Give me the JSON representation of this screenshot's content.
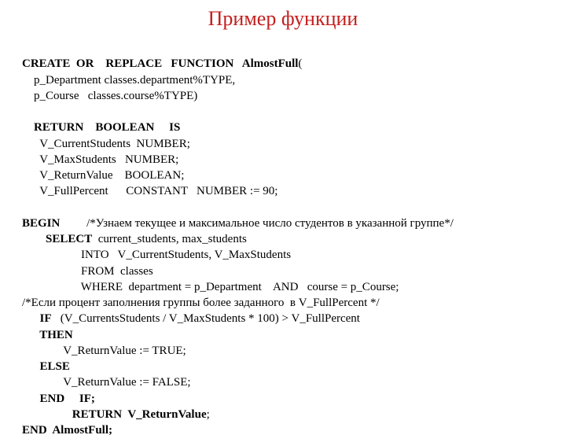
{
  "title": "Пример функции",
  "lines": {
    "l1a": "CREATE  OR    REPLACE   FUNCTION   AlmostFull",
    "l1b": "(",
    "l2": "    p_Department classes.department%TYPE,",
    "l3": "    p_Course   classes.course%TYPE)",
    "blank1": "",
    "l4a": "    RETURN    BOOLEAN     IS",
    "l5": "      V_CurrentStudents  NUMBER;",
    "l6": "      V_MaxStudents   NUMBER;",
    "l7": "      V_ReturnValue    BOOLEAN;",
    "l8": "      V_FullPercent      CONSTANT   NUMBER := 90;",
    "blank2": "",
    "l9a": "BEGIN",
    "l9b": "         /*Узнаем текущее и максимальное число студентов в указанной группе*/",
    "l10a": "        SELECT",
    "l10b": "  current_students, max_students",
    "l11": "                    INTO   V_CurrentStudents, V_MaxStudents",
    "l12": "                    FROM  classes",
    "l13": "                    WHERE  department = p_Department    AND   course = p_Course;",
    "l14": "/*Если процент заполнения группы более заданного  в V_FullPercent */",
    "l15a": "      IF",
    "l15b": "   (V_CurrentsStudents / V_MaxStudents * 100) > V_FullPercent",
    "l16": "      THEN",
    "l17": "              V_ReturnValue := TRUE;",
    "l18": "      ELSE",
    "l19": "              V_ReturnValue := FALSE;",
    "l20": "      END     IF;",
    "l21": "                 RETURN  V_ReturnValue",
    "l21b": ";",
    "l22": "END  AlmostFull;"
  }
}
